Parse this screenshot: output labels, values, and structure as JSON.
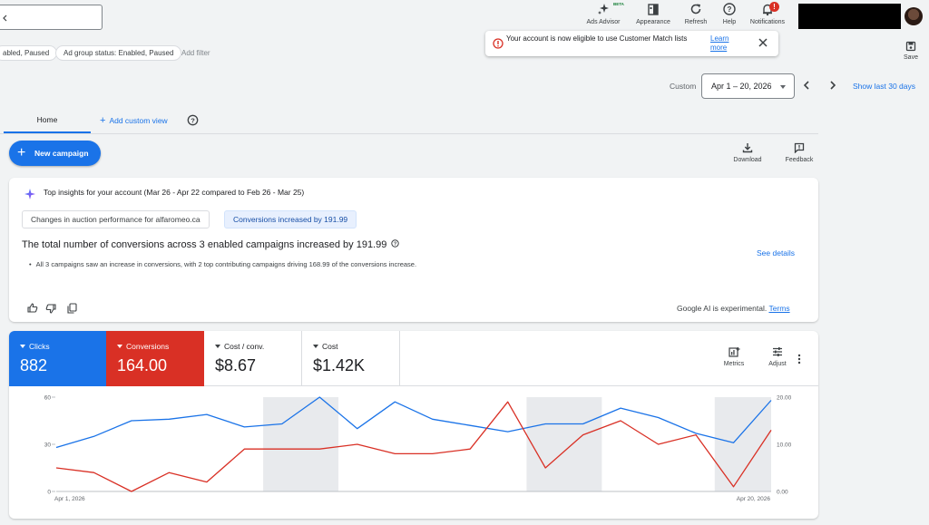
{
  "topbar": {
    "ads_advisor": "Ads Advisor",
    "beta": "BETA",
    "appearance": "Appearance",
    "refresh": "Refresh",
    "help": "Help",
    "notifications": "Notifications",
    "notifications_count": "!"
  },
  "filters": {
    "chip1": "abled, Paused",
    "chip2": "Ad group status: Enabled, Paused",
    "add_filter": "Add filter"
  },
  "banner": {
    "message": "Your account is now eligible to use Customer Match lists",
    "link": "Learn more"
  },
  "save_label": "Save",
  "date": {
    "custom_label": "Custom",
    "range": "Apr 1 – 20, 2026",
    "show_last": "Show last 30 days"
  },
  "tabs": {
    "home": "Home",
    "add_custom_view": "Add custom view"
  },
  "actions": {
    "new_campaign": "New campaign",
    "download": "Download",
    "feedback": "Feedback"
  },
  "insights": {
    "title": "Top insights for your account (Mar 26 - Apr 22 compared to Feb 26 - Mar 25)",
    "chip_auction": "Changes in auction performance for alfaromeo.ca",
    "chip_conversions": "Conversions increased by 191.99",
    "headline": "The total number of conversions across 3 enabled campaigns increased by 191.99",
    "bullet": "All 3 campaigns saw an increase in conversions, with 2 top contributing campaigns driving 168.99 of the conversions increase.",
    "see_details": "See details",
    "ai_note": "Google AI is experimental.",
    "terms": "Terms"
  },
  "metrics": {
    "clicks_label": "Clicks",
    "clicks_value": "882",
    "conversions_label": "Conversions",
    "conversions_value": "164.00",
    "cost_conv_label": "Cost / conv.",
    "cost_conv_value": "$8.67",
    "cost_label": "Cost",
    "cost_value": "$1.42K",
    "metrics_btn": "Metrics",
    "adjust_btn": "Adjust"
  },
  "colors": {
    "clicks": "#1a73e8",
    "conversions": "#d93025",
    "weekend_band": "#e8eaed"
  },
  "chart_data": {
    "type": "line",
    "x_start_label": "Apr 1, 2026",
    "x_end_label": "Apr 20, 2026",
    "y_left_ticks": [
      "60",
      "30",
      "0"
    ],
    "y_left_lim": [
      0,
      60
    ],
    "y_right_ticks": [
      "20.00",
      "10.00",
      "0.00"
    ],
    "y_right_lim": [
      0,
      20
    ],
    "weekend_bands": [
      [
        6,
        7
      ],
      [
        13,
        14
      ],
      [
        18,
        19
      ]
    ],
    "series": [
      {
        "name": "Clicks",
        "axis": "left",
        "values": [
          28,
          35,
          45,
          46,
          49,
          41,
          43,
          60,
          40,
          57,
          46,
          42,
          38,
          43,
          43,
          53,
          47,
          37,
          31,
          58
        ]
      },
      {
        "name": "Conversions",
        "axis": "right",
        "values": [
          5,
          4,
          0,
          4,
          2,
          9,
          9,
          9,
          10,
          8,
          8,
          9,
          19,
          5,
          12,
          15,
          10,
          12,
          1,
          13
        ]
      }
    ]
  }
}
